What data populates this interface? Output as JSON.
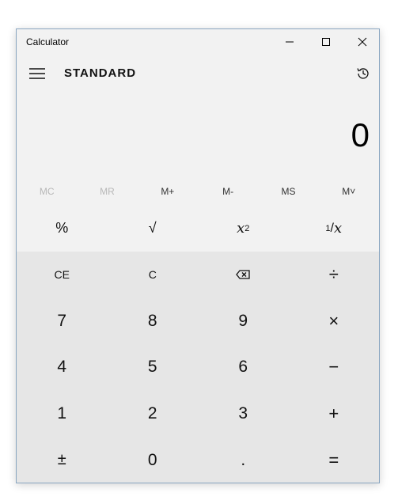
{
  "window": {
    "title": "Calculator"
  },
  "header": {
    "mode": "STANDARD"
  },
  "display": {
    "value": "0"
  },
  "memory": [
    {
      "label": "MC",
      "enabled": false
    },
    {
      "label": "MR",
      "enabled": false
    },
    {
      "label": "M+",
      "enabled": true
    },
    {
      "label": "M-",
      "enabled": true
    },
    {
      "label": "MS",
      "enabled": true
    },
    {
      "label": "M˅",
      "enabled": true
    }
  ],
  "functions": {
    "percent": "%",
    "sqrt": "√",
    "square_base": "x",
    "square_exp": "2",
    "reciprocal_num": "1",
    "reciprocal_den": "x"
  },
  "keypad": {
    "ce": "CE",
    "c": "C",
    "backspace_icon": "backspace-icon",
    "divide": "÷",
    "seven": "7",
    "eight": "8",
    "nine": "9",
    "multiply": "×",
    "four": "4",
    "five": "5",
    "six": "6",
    "minus": "−",
    "one": "1",
    "two": "2",
    "three": "3",
    "plus": "+",
    "negate": "±",
    "zero": "0",
    "decimal": ".",
    "equals": "="
  },
  "icons": {
    "menu": "hamburger-icon",
    "history": "history-icon",
    "minimize": "minimize-icon",
    "maximize": "maximize-icon",
    "close": "close-icon"
  },
  "colors": {
    "window_bg": "#f2f2f2",
    "keypad_bg": "#e6e6e6",
    "border": "#8aa6c1",
    "disabled_text": "#b8b8b8"
  }
}
